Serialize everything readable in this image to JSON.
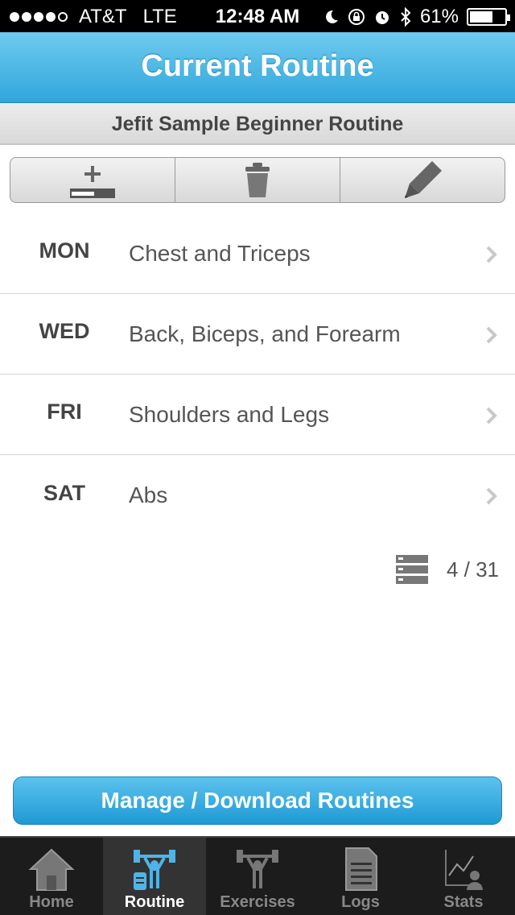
{
  "status": {
    "carrier": "AT&T",
    "network": "LTE",
    "time": "12:48 AM",
    "battery": "61%",
    "battery_level": 0.61
  },
  "header": {
    "title": "Current Routine"
  },
  "routine": {
    "name": "Jefit Sample Beginner Routine"
  },
  "toolbar": {
    "icons": [
      "add-day-icon",
      "trash-icon",
      "pencil-icon"
    ]
  },
  "days": [
    {
      "day": "MON",
      "name": "Chest and Triceps"
    },
    {
      "day": "WED",
      "name": "Back, Biceps, and Forearm"
    },
    {
      "day": "FRI",
      "name": "Shoulders and Legs"
    },
    {
      "day": "SAT",
      "name": "Abs"
    }
  ],
  "counter": {
    "text": "4 / 31"
  },
  "manage_button": {
    "label": "Manage / Download Routines"
  },
  "tabs": [
    {
      "label": "Home",
      "active": false
    },
    {
      "label": "Routine",
      "active": true
    },
    {
      "label": "Exercises",
      "active": false
    },
    {
      "label": "Logs",
      "active": false
    },
    {
      "label": "Stats",
      "active": false
    }
  ],
  "colors": {
    "accent": "#31a6dc",
    "tab_active": "#4fb4e6"
  }
}
